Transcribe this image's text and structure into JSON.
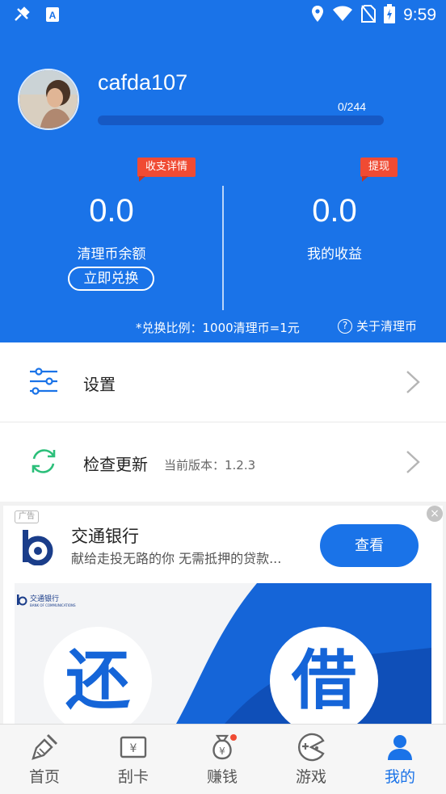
{
  "status_bar": {
    "time": "9:59",
    "icons": [
      "airplane-tool-icon",
      "accessibility-a-icon",
      "location-icon",
      "wifi-icon",
      "no-sim-icon",
      "battery-charging-icon"
    ]
  },
  "profile": {
    "username": "cafda107",
    "progress_text": "0/244",
    "progress_fraction": 0
  },
  "balances": {
    "coin_balance": {
      "value": "0.0",
      "label": "清理币余额",
      "tag": "收支详情",
      "action": "立即兑换"
    },
    "earnings": {
      "value": "0.0",
      "label": "我的收益",
      "tag": "提现"
    },
    "ratio_text": "*兑换比例：1000清理币=1元",
    "about_label": "关于清理币"
  },
  "menu": {
    "settings": {
      "label": "设置"
    },
    "update": {
      "label": "检查更新",
      "version": "当前版本：1.2.3"
    }
  },
  "ad": {
    "tag": "广告",
    "close": "×",
    "title": "交通银行",
    "description": "献给走投无路的你 无需抵押的贷款...",
    "button": "查看",
    "banner_bank_name": "交通银行",
    "banner_bank_en": "BANK OF COMMUNICATIONS",
    "banner_left_char": "还",
    "banner_right_char": "借"
  },
  "bottom_nav": [
    {
      "label": "首页",
      "icon": "broom-icon",
      "active": false
    },
    {
      "label": "刮卡",
      "icon": "scratch-card-icon",
      "active": false
    },
    {
      "label": "赚钱",
      "icon": "money-bag-icon",
      "active": false,
      "badge": true
    },
    {
      "label": "游戏",
      "icon": "game-controller-icon",
      "active": false
    },
    {
      "label": "我的",
      "icon": "user-icon",
      "active": true
    }
  ],
  "colors": {
    "primary": "#1a73e8",
    "tag_red": "#f04b33",
    "refresh_green": "#2cbf7a"
  }
}
